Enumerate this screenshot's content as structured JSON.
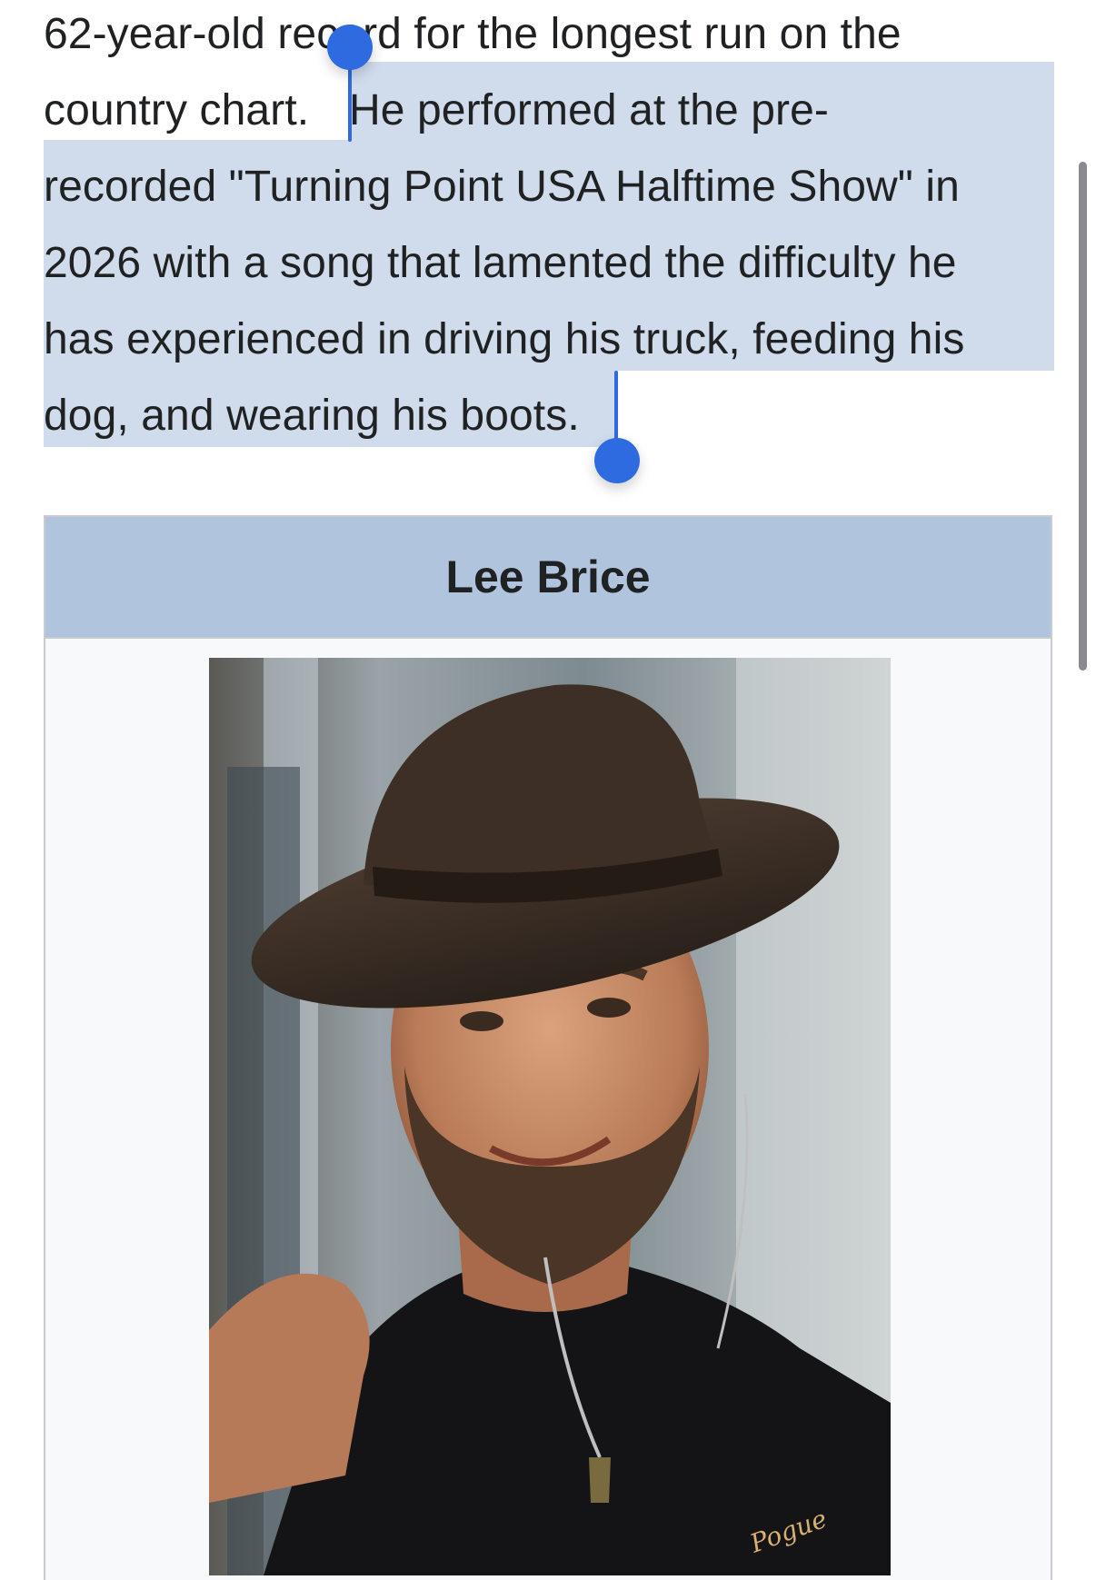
{
  "article": {
    "lines": [
      "62-year-old record for the longest run on the",
      "country chart.",
      "He performed at the pre-",
      "recorded \"Turning Point USA Halftime Show\" in",
      "2026 with a song that lamented the difficulty he",
      "has experienced in driving his truck, feeding his",
      "dog, and wearing his boots."
    ]
  },
  "infobox": {
    "title": "Lee Brice",
    "photo_caption_logo": "Pogue"
  },
  "colors": {
    "selection": "#d0dcec",
    "handle": "#2f6be0",
    "infobox_header": "#b0c4de",
    "infobox_border": "#c8ccd1",
    "infobox_bg": "#f8f9fa"
  }
}
